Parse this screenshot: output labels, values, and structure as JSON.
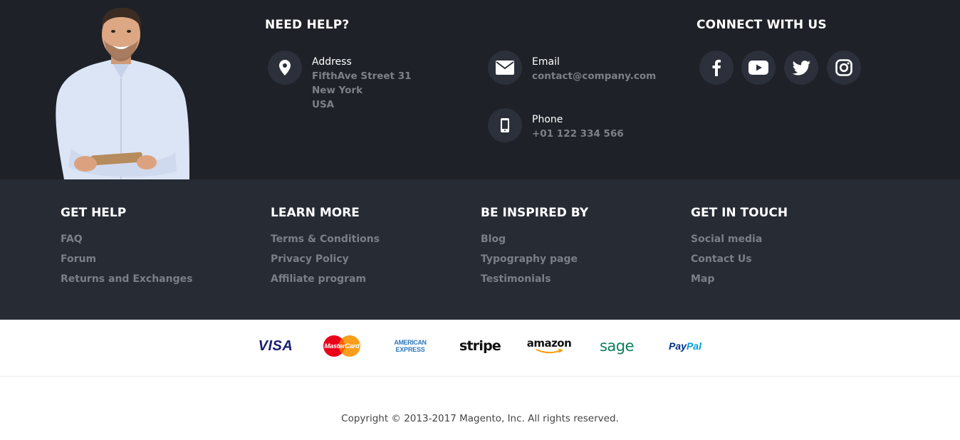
{
  "need_help": {
    "title": "NEED HELP?",
    "address": {
      "label": "Address",
      "lines": [
        "FifthAve Street 31",
        "New York",
        "USA"
      ]
    },
    "email": {
      "label": "Email",
      "value": "contact@company.com"
    },
    "phone": {
      "label": "Phone",
      "value": "+01 122 334 566"
    }
  },
  "connect": {
    "title": "CONNECT WITH US",
    "icons": [
      "facebook-icon",
      "youtube-icon",
      "twitter-icon",
      "instagram-icon"
    ]
  },
  "columns": [
    {
      "title": "GET HELP",
      "links": [
        "FAQ",
        "Forum",
        "Returns and Exchanges"
      ]
    },
    {
      "title": "LEARN MORE",
      "links": [
        "Terms & Conditions",
        "Privacy Policy",
        "Affiliate program"
      ]
    },
    {
      "title": "BE INSPIRED BY",
      "links": [
        "Blog",
        "Typography page",
        "Testimonials"
      ]
    },
    {
      "title": "GET IN TOUCH",
      "links": [
        "Social media",
        "Contact Us",
        "Map"
      ]
    }
  ],
  "payments": {
    "visa": "VISA",
    "mastercard": "MasterCard",
    "amex_top": "AMERICAN",
    "amex_bottom": "EXPRESS",
    "stripe": "stripe",
    "amazon": "amazon",
    "sage": "sage",
    "paypal_pay": "Pay",
    "paypal_pal": "Pal"
  },
  "copyright": "Copyright © 2013-2017 Magento, Inc. All rights reserved.",
  "colors": {
    "top_bg": "#1e2127",
    "links_bg": "#262b34",
    "icon_circle": "#2b303a",
    "muted_text": "#7b7f87"
  }
}
